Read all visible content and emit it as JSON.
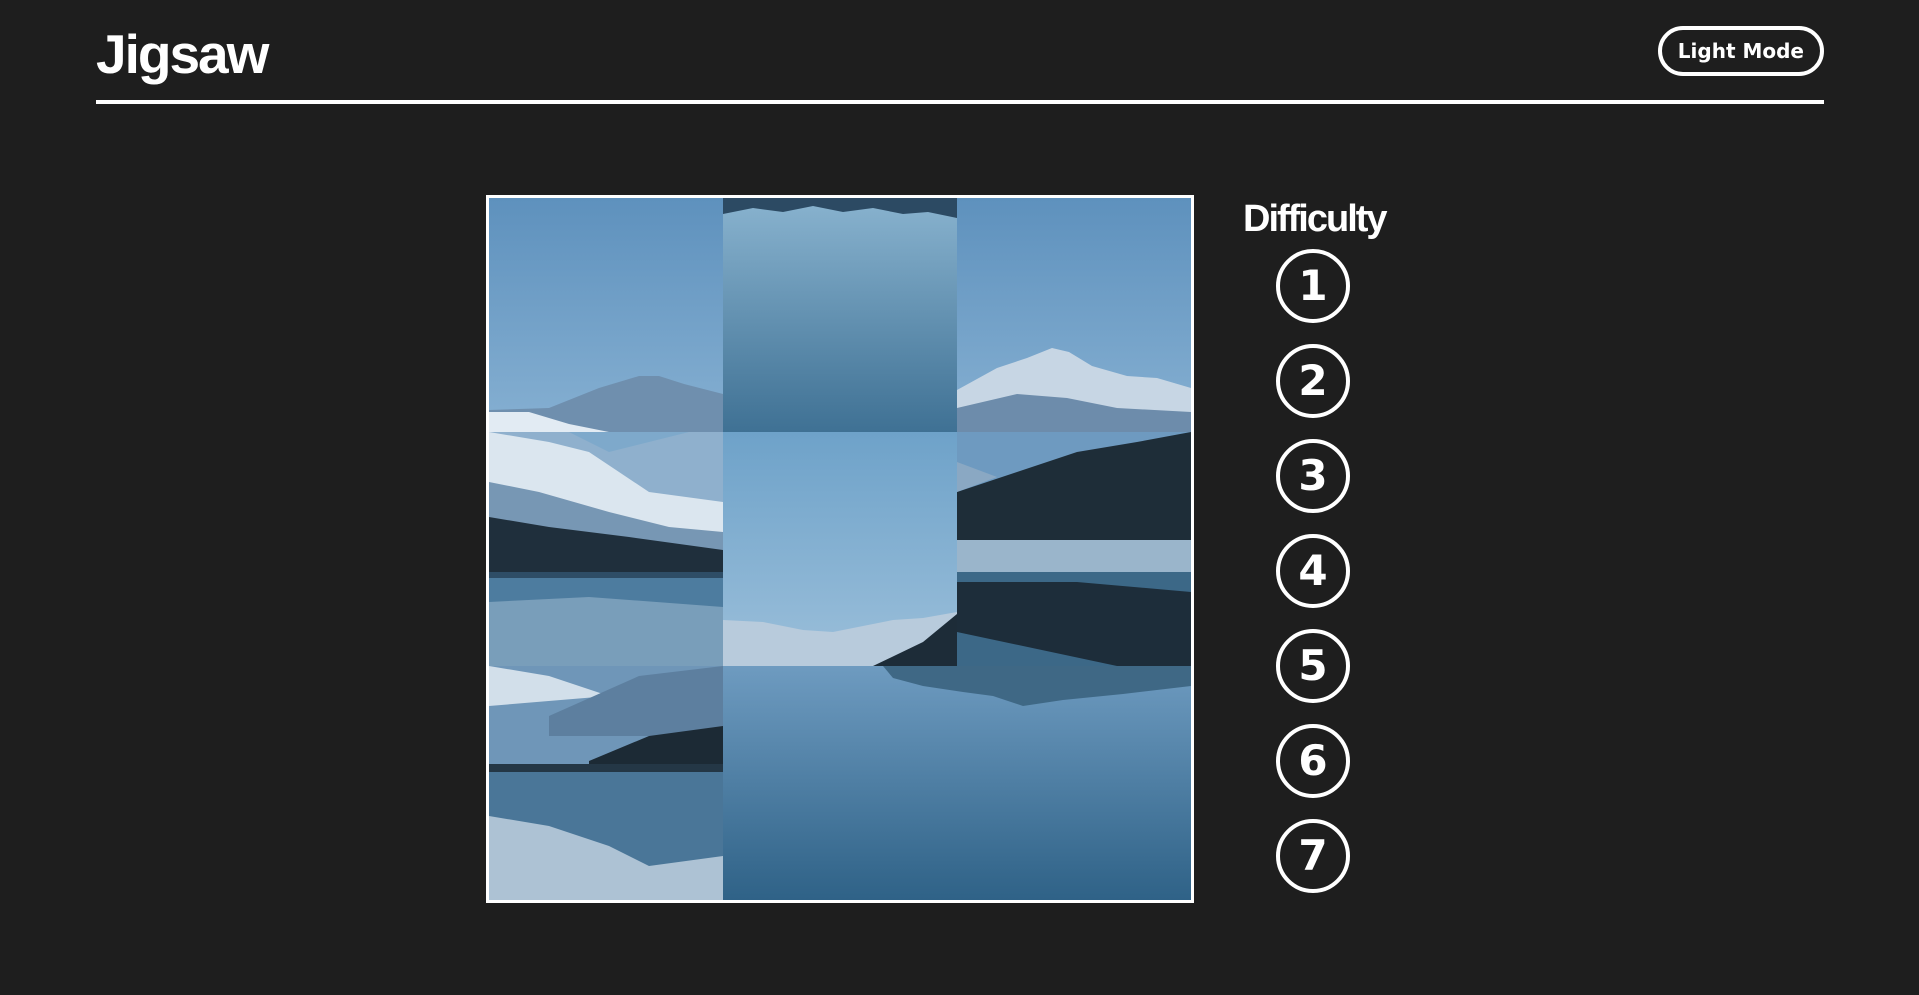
{
  "app": {
    "title": "Jigsaw",
    "mode_toggle_label": "Light Mode"
  },
  "puzzle": {
    "grid": "3x3",
    "image_subject": "mountain-lake-reflection",
    "tiles_visible": 7
  },
  "difficulty": {
    "heading": "Difficulty",
    "levels": [
      "1",
      "2",
      "3",
      "4",
      "5",
      "6",
      "7"
    ]
  },
  "colors": {
    "background": "#1e1e1e",
    "foreground": "#ffffff",
    "sky": "#6d9ec7",
    "water": "#3f7194",
    "mountain_dark": "#1f2f3c"
  }
}
